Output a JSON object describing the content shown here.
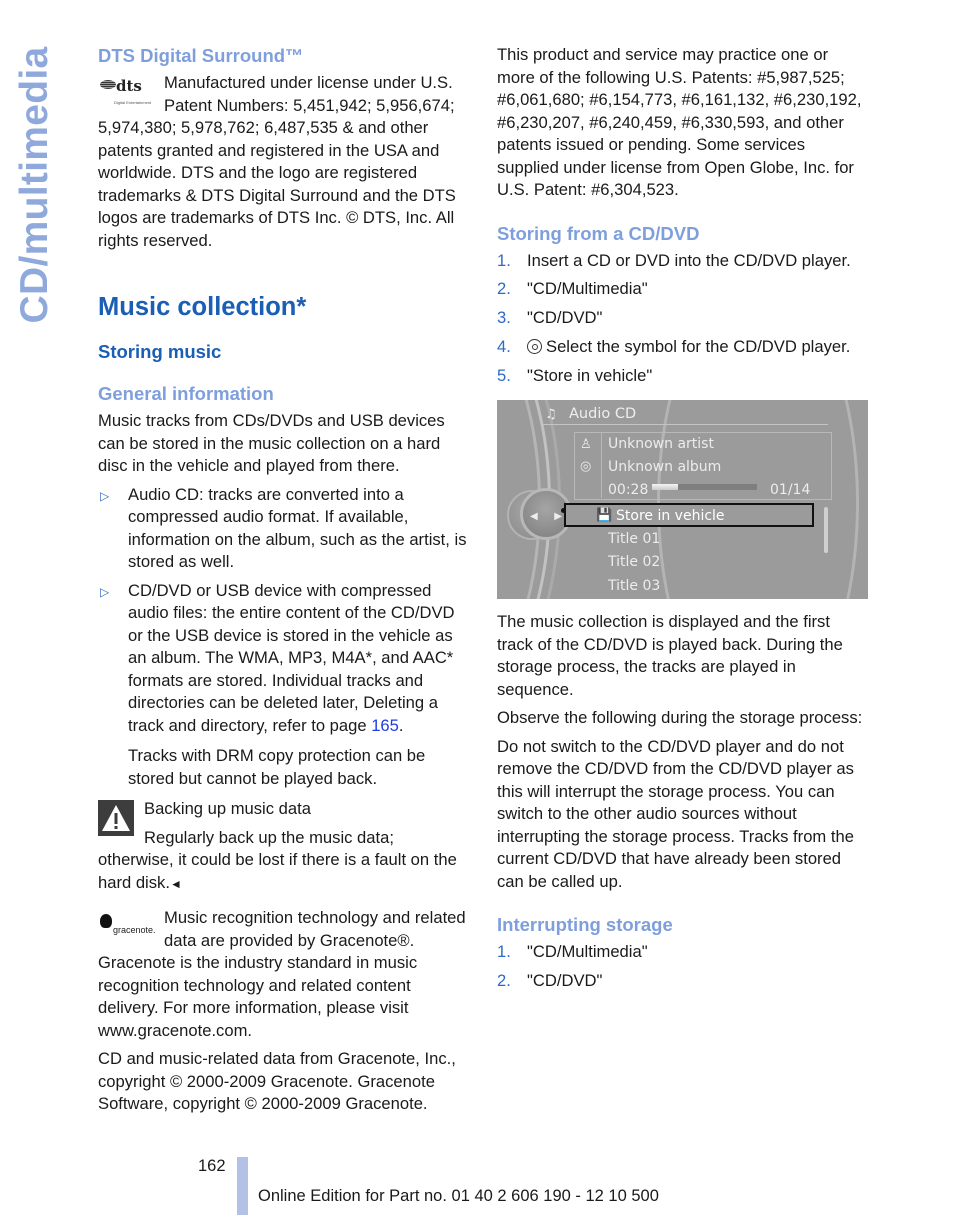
{
  "side_tab": "CD/multimedia",
  "left": {
    "dts_heading": "DTS Digital Surround™",
    "dts_logo": {
      "word": "dts",
      "sub": "Digital Entertainment",
      "icon": "dts-logo-icon"
    },
    "dts_text": "Manufactured under license under U.S. Patent Numbers: 5,451,942; 5,956,674; 5,974,380; 5,978,762; 6,487,535 & and other patents granted and registered in the USA and worldwide. DTS and the logo are registered trademarks & DTS Digital Surround and the DTS logos are trademarks of DTS Inc. © DTS, Inc. All rights reserved.",
    "music_heading": "Music collection*",
    "storing_heading": "Storing music",
    "general_heading": "General information",
    "general_text": "Music tracks from CDs/DVDs and USB devices can be stored in the music collection on a hard disc in the vehicle and played from there.",
    "bullets": [
      {
        "text": "Audio CD: tracks are converted into a compressed audio format. If available, information on the album, such as the artist, is stored as well."
      },
      {
        "text_before_link": "CD/DVD or USB device with compressed audio files: the entire content of the CD/DVD or the USB device is stored in the vehicle as an album. The WMA, MP3, M4A*, and AAC* formats are stored. Individual tracks and directories can be deleted later, Deleting a track and directory, refer to page ",
        "link": "165",
        "text_after_link": "."
      }
    ],
    "drm_note": "Tracks with DRM copy protection can be stored but cannot be played back.",
    "warning": {
      "icon": "warning-triangle-icon",
      "title": "Backing up music data",
      "text": "Regularly back up the music data; otherwise, it could be lost if there is a fault on the hard disk.",
      "end_mark": "◄"
    },
    "gracenote_logo": {
      "text": "gracenote.",
      "icon": "gracenote-logo-icon"
    },
    "gracenote_text": "Music recognition technology and related data are provided by Gracenote®. Gracenote is the industry standard in music recognition technology and related content delivery. For more information, please visit www.gracenote.com.",
    "gracenote_copyright": "CD and music-related data from Gracenote, Inc., copyright © 2000-2009 Gracenote. Gracenote Software, copyright © 2000-2009 Gracenote."
  },
  "right": {
    "patents_text": "This product and service may practice one or more of the following U.S. Patents: #5,987,525; #6,061,680; #6,154,773, #6,161,132, #6,230,192, #6,230,207, #6,240,459, #6,330,593, and other patents issued or pending. Some services supplied under license from Open Globe, Inc. for U.S. Patent: #6,304,523.",
    "storing_cd_heading": "Storing from a CD/DVD",
    "storing_steps": [
      {
        "num": "1.",
        "text": "Insert a CD or DVD into the CD/DVD player."
      },
      {
        "num": "2.",
        "text": "\"CD/Multimedia\""
      },
      {
        "num": "3.",
        "text": "\"CD/DVD\""
      },
      {
        "num": "4.",
        "text": "Select the symbol for the CD/DVD player.",
        "icon": "cd-icon"
      },
      {
        "num": "5.",
        "text": "\"Store in vehicle\""
      }
    ],
    "screen": {
      "title": "Audio CD",
      "artist": "Unknown artist",
      "album": "Unknown album",
      "elapsed": "00:28",
      "progress": 0.25,
      "track_counter": "01/14",
      "selected_item": "Store in vehicle",
      "items": [
        "Title  01",
        "Title  02",
        "Title  03"
      ]
    },
    "after_text": "The music collection is displayed and the first track of the CD/DVD is played back. During the storage process, the tracks are played in sequence.",
    "observe_text": "Observe the following during the storage process:",
    "do_not_text": "Do not switch to the CD/DVD player and do not remove the CD/DVD from the CD/DVD player as this will interrupt the storage process. You can switch to the other audio sources without interrupting the storage process. Tracks from the current CD/DVD that have already been stored can be called up.",
    "interrupt_heading": "Interrupting storage",
    "interrupt_steps": [
      {
        "num": "1.",
        "text": "\"CD/Multimedia\""
      },
      {
        "num": "2.",
        "text": "\"CD/DVD\""
      }
    ]
  },
  "footer": {
    "page_number": "162",
    "edition": "Online Edition for Part no. 01 40 2 606 190 - 12 10 500"
  }
}
